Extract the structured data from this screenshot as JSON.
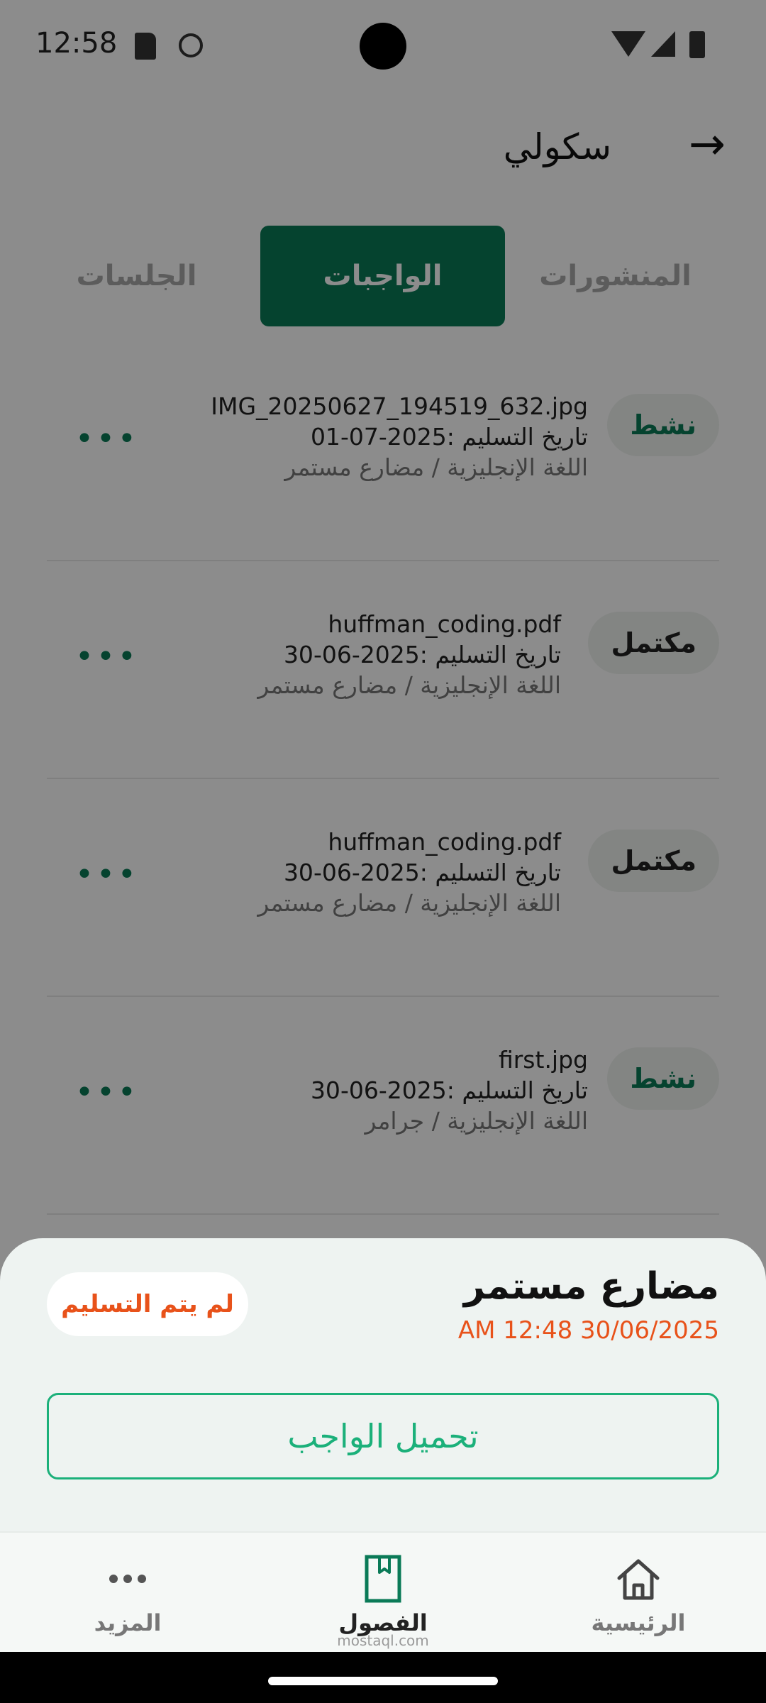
{
  "status_bar": {
    "time": "12:58"
  },
  "header": {
    "title": "سكولي",
    "back_icon": "arrow-right-icon"
  },
  "tabs": [
    {
      "label": "المنشورات"
    },
    {
      "label": "الواجبات",
      "selected": true
    },
    {
      "label": "الجلسات"
    }
  ],
  "assignments": [
    {
      "file": "IMG_20250627_194519_632.jpg",
      "due": "تاريخ التسليم :2025-07-01",
      "course": "اللغة الإنجليزية / مضارع مستمر",
      "status": "نشط"
    },
    {
      "file": "huffman_coding.pdf",
      "due": "تاريخ التسليم :2025-06-30",
      "course": "اللغة الإنجليزية / مضارع مستمر",
      "status": "مكتمل"
    },
    {
      "file": "huffman_coding.pdf",
      "due": "تاريخ التسليم :2025-06-30",
      "course": "اللغة الإنجليزية / مضارع مستمر",
      "status": "مكتمل"
    },
    {
      "file": "first.jpg",
      "due": "تاريخ التسليم :2025-06-30",
      "course": "اللغة الإنجليزية / جرامر",
      "status": "نشط"
    }
  ],
  "sheet": {
    "title": "مضارع مستمر",
    "datetime": "AM 12:48 30/06/2025",
    "status": "لم يتم التسليم",
    "upload_label": "تحميل الواجب"
  },
  "bottom_nav": [
    {
      "label": "الرئيسية",
      "icon": "home-icon"
    },
    {
      "label": "الفصول",
      "icon": "bookmark-book-icon",
      "selected": true
    },
    {
      "label": "المزيد",
      "icon": "more-dots-icon"
    }
  ],
  "watermark": "mostaql.com",
  "colors": {
    "primary": "#0a7a57",
    "accent": "#1bb07a",
    "warning": "#e8521a"
  }
}
